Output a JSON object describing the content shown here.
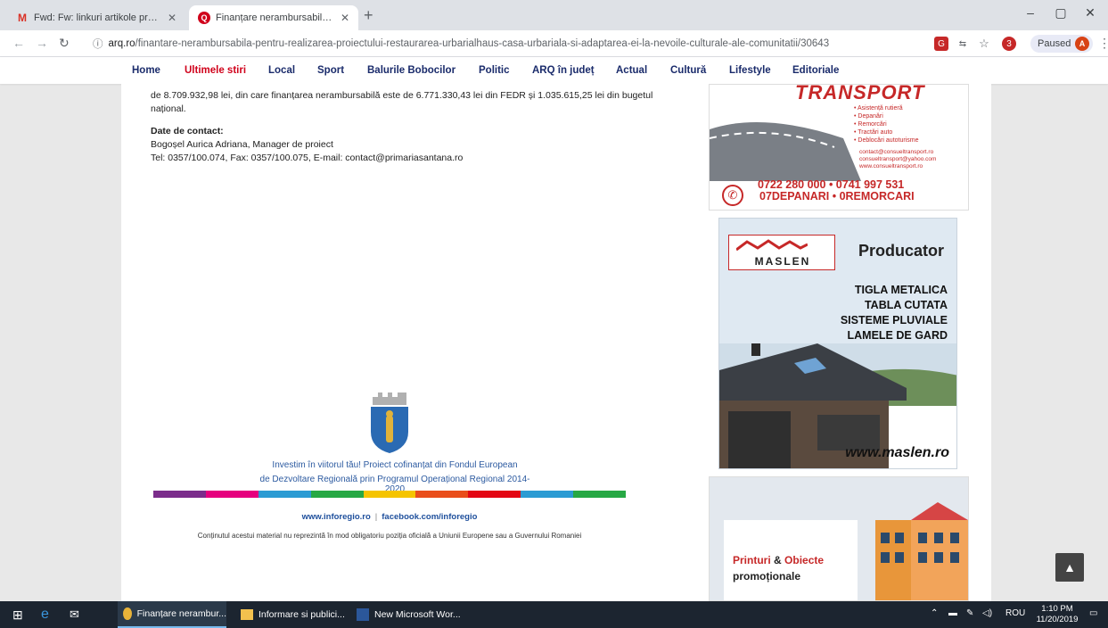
{
  "browser": {
    "tabs": [
      {
        "title": "Fwd: Fw: linkuri artikole proiecte",
        "icon": "gmail-icon",
        "active": false
      },
      {
        "title": "Finanțare nerambursabilă pentru",
        "icon": "site-favicon",
        "active": true
      }
    ],
    "url_domain": "arq.ro",
    "url_path": "/finantare-nerambursabila-pentru-realizarea-proiectului-restaurarea-urbarialhaus-casa-urbariala-si-adaptarea-ei-la-nevoile-culturale-ale-comunitatii/30643",
    "profile_status": "Paused",
    "profile_initial": "A",
    "ext_badge": "3"
  },
  "site_nav": [
    "Home",
    "Ultimele stiri",
    "Local",
    "Sport",
    "Balurile Bobocilor",
    "Politic",
    "ARQ în județ",
    "Actual",
    "Cultură",
    "Lifestyle",
    "Editoriale"
  ],
  "article": {
    "para1": "de 8.709.932,98 lei, din care finanțarea nerambursabilă este de 6.771.330,43 lei din FEDR și 1.035.615,25 lei din bugetul național.",
    "contact_heading": "Date de contact:",
    "contact_name": "Bogoșel Aurica Adriana, Manager de proiect",
    "contact_line": "Tel: 0357/100.074, Fax: 0357/100.075, E-mail: contact@primariasantana.ro"
  },
  "poster": {
    "line1": "Investim în viitorul tău! Proiect cofinanțat din Fondul European",
    "line2": "de Dezvoltare Regională prin Programul Operațional Regional 2014-2020",
    "link1": "www.inforegio.ro",
    "separator": "|",
    "link2": "facebook.com/inforegio",
    "disclaimer": "Conținutul acestui material nu reprezintă în mod obligatoriu poziția oficială a Uniunii Europene sau a Guvernului Romaniei",
    "ribbon_colors": [
      "#7b2d8b",
      "#e6007e",
      "#2b9bd3",
      "#27a844",
      "#f5c400",
      "#e94e1b",
      "#e30613",
      "#2b9bd3",
      "#27a844"
    ]
  },
  "ads": {
    "transport": {
      "brand": "TRANSPORT",
      "services": [
        "• Asistență rutieră",
        "• Depanări",
        "• Remorcări",
        "• Tractări auto",
        "• Deblocări autoturisme"
      ],
      "contacts": [
        "contact@consueltransport.ro",
        "consueltransport@yahoo.com",
        "www.consueltransport.ro"
      ],
      "phones": "0722 280 000 • 0741 997 531",
      "slogan": "07DEPANARI • 0REMORCARI"
    },
    "maslen": {
      "brand": "MASLEN",
      "headline": "Producator",
      "features": [
        "TIGLA METALICA",
        "TABLA CUTATA",
        "SISTEME PLUVIALE",
        "LAMELE DE GARD"
      ],
      "site": "www.maslen.ro"
    },
    "printuri": {
      "word1": "Printuri",
      "amp": "&",
      "word2": "Obiecte",
      "line2": "promoționale"
    }
  },
  "taskbar": {
    "apps": [
      "Finanțare nerambur...",
      "Informare si publici...",
      "New Microsoft Wor..."
    ],
    "lang": "ROU",
    "time": "1:10 PM",
    "date": "11/20/2019"
  }
}
